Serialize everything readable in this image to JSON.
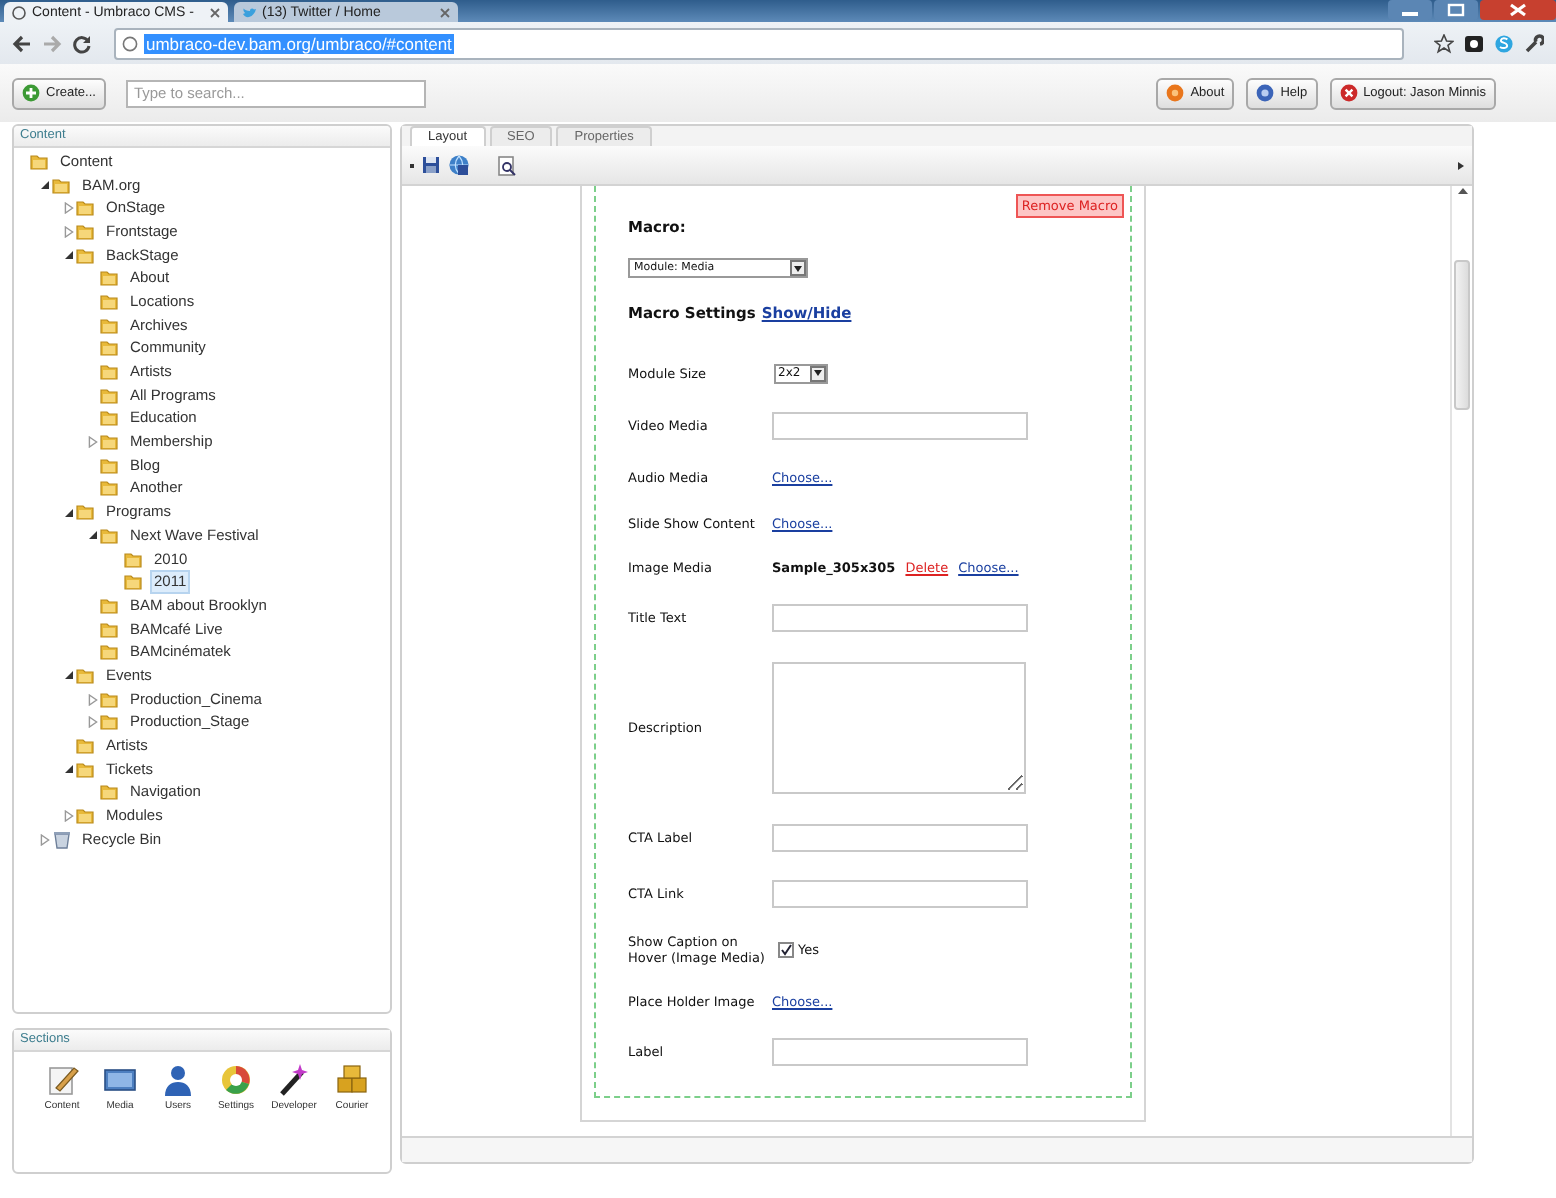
{
  "browser": {
    "tabs": [
      {
        "title": "Content - Umbraco CMS -",
        "selected": true
      },
      {
        "title": "(13) Twitter / Home",
        "selected": false
      }
    ],
    "address": {
      "url": "umbraco-dev.bam.org/umbraco/#content",
      "highlighted": true
    }
  },
  "toolbar": {
    "create": "Create...",
    "search": {
      "placeholder": "Type to search..."
    },
    "buttons": [
      {
        "label": "About",
        "kind": "about"
      },
      {
        "label": "Help",
        "kind": "help"
      },
      {
        "label": "Logout: Jason Minnis",
        "kind": "logout"
      }
    ]
  },
  "tree": {
    "title": "Content",
    "items": [
      {
        "label": "Content",
        "kind": "folder",
        "selected": false,
        "children": [
          {
            "label": "BAM.org",
            "kind": "folder",
            "selected": false,
            "expanded": true,
            "children": [
              {
                "label": "OnStage",
                "kind": "folder",
                "selected": false,
                "expanded": false
              },
              {
                "label": "Frontstage",
                "kind": "folder",
                "selected": false,
                "expanded": false
              },
              {
                "label": "BackStage",
                "kind": "folder",
                "selected": false,
                "expanded": true,
                "children": [
                  {
                    "label": "About",
                    "kind": "folder",
                    "selected": false
                  },
                  {
                    "label": "Locations",
                    "kind": "folder",
                    "selected": false
                  },
                  {
                    "label": "Archives",
                    "kind": "folder",
                    "selected": false
                  },
                  {
                    "label": "Community",
                    "kind": "folder",
                    "selected": false
                  },
                  {
                    "label": "Artists",
                    "kind": "folder",
                    "selected": false
                  },
                  {
                    "label": "All Programs",
                    "kind": "folder",
                    "selected": false
                  },
                  {
                    "label": "Education",
                    "kind": "folder",
                    "selected": false
                  },
                  {
                    "label": "Membership",
                    "kind": "folder",
                    "selected": false,
                    "expanded": false
                  },
                  {
                    "label": "Blog",
                    "kind": "folder",
                    "selected": false
                  },
                  {
                    "label": "Another",
                    "kind": "folder",
                    "selected": false
                  }
                ]
              },
              {
                "label": "Programs",
                "kind": "folder",
                "selected": false,
                "expanded": true,
                "children": [
                  {
                    "label": "Next Wave Festival",
                    "kind": "folder",
                    "selected": false,
                    "expanded": true,
                    "children": [
                      {
                        "label": "2010",
                        "kind": "folder",
                        "selected": false
                      },
                      {
                        "label": "2011",
                        "kind": "folder",
                        "selected": true
                      }
                    ]
                  },
                  {
                    "label": "BAM about Brooklyn",
                    "kind": "folder",
                    "selected": false
                  },
                  {
                    "label": "BAMcafé Live",
                    "kind": "folder",
                    "selected": false
                  },
                  {
                    "label": "BAMcinématek",
                    "kind": "folder",
                    "selected": false
                  }
                ]
              },
              {
                "label": "Events",
                "kind": "folder",
                "selected": false,
                "expanded": true,
                "children": [
                  {
                    "label": "Production_Cinema",
                    "kind": "folder",
                    "selected": false,
                    "expanded": false
                  },
                  {
                    "label": "Production_Stage",
                    "kind": "folder",
                    "selected": false,
                    "expanded": false
                  }
                ]
              },
              {
                "label": "Artists",
                "kind": "folder",
                "selected": false
              },
              {
                "label": "Tickets",
                "kind": "folder",
                "selected": false,
                "expanded": true,
                "children": [
                  {
                    "label": "Navigation",
                    "kind": "folder",
                    "selected": false
                  }
                ]
              },
              {
                "label": "Modules",
                "kind": "folder",
                "selected": false,
                "expanded": false
              }
            ]
          },
          {
            "label": "Recycle Bin",
            "kind": "bin",
            "selected": false,
            "expanded": false
          }
        ]
      }
    ]
  },
  "sections": {
    "title": "Sections",
    "items": [
      {
        "label": "Content",
        "kind": "content"
      },
      {
        "label": "Media",
        "kind": "media"
      },
      {
        "label": "Users",
        "kind": "users"
      },
      {
        "label": "Settings",
        "kind": "settings"
      },
      {
        "label": "Developer",
        "kind": "developer"
      },
      {
        "label": "Courier",
        "kind": "courier"
      }
    ]
  },
  "editor": {
    "tabs": [
      {
        "label": "Layout",
        "selected": true
      },
      {
        "label": "SEO",
        "selected": false
      },
      {
        "label": "Properties",
        "selected": false
      }
    ],
    "macro": {
      "remove": "Remove Macro",
      "label": "Macro:",
      "select": "Module: Media",
      "settings_title": "Macro Settings",
      "settings_link": "Show/Hide"
    },
    "fields": [
      {
        "label": "Module Size",
        "kind": "select",
        "value": "2x2"
      },
      {
        "label": "Video Media",
        "kind": "text"
      },
      {
        "label": "Audio Media",
        "kind": "choose",
        "link": "Choose..."
      },
      {
        "label": "Slide Show Content",
        "kind": "choose",
        "link": "Choose..."
      },
      {
        "label": "Image Media",
        "kind": "media",
        "value": "Sample_305x305",
        "delete": "Delete",
        "link": "Choose..."
      },
      {
        "label": "Title Text",
        "kind": "text"
      },
      {
        "label": "Description",
        "kind": "textarea"
      },
      {
        "label": "CTA Label",
        "kind": "text"
      },
      {
        "label": "CTA Link",
        "kind": "text"
      },
      {
        "label": "Show Caption on Hover (Image Media)",
        "kind": "checkbox",
        "checked": true,
        "option": "Yes"
      },
      {
        "label": "Place Holder Image",
        "kind": "choose",
        "link": "Choose..."
      },
      {
        "label": "Label",
        "kind": "text"
      }
    ]
  }
}
